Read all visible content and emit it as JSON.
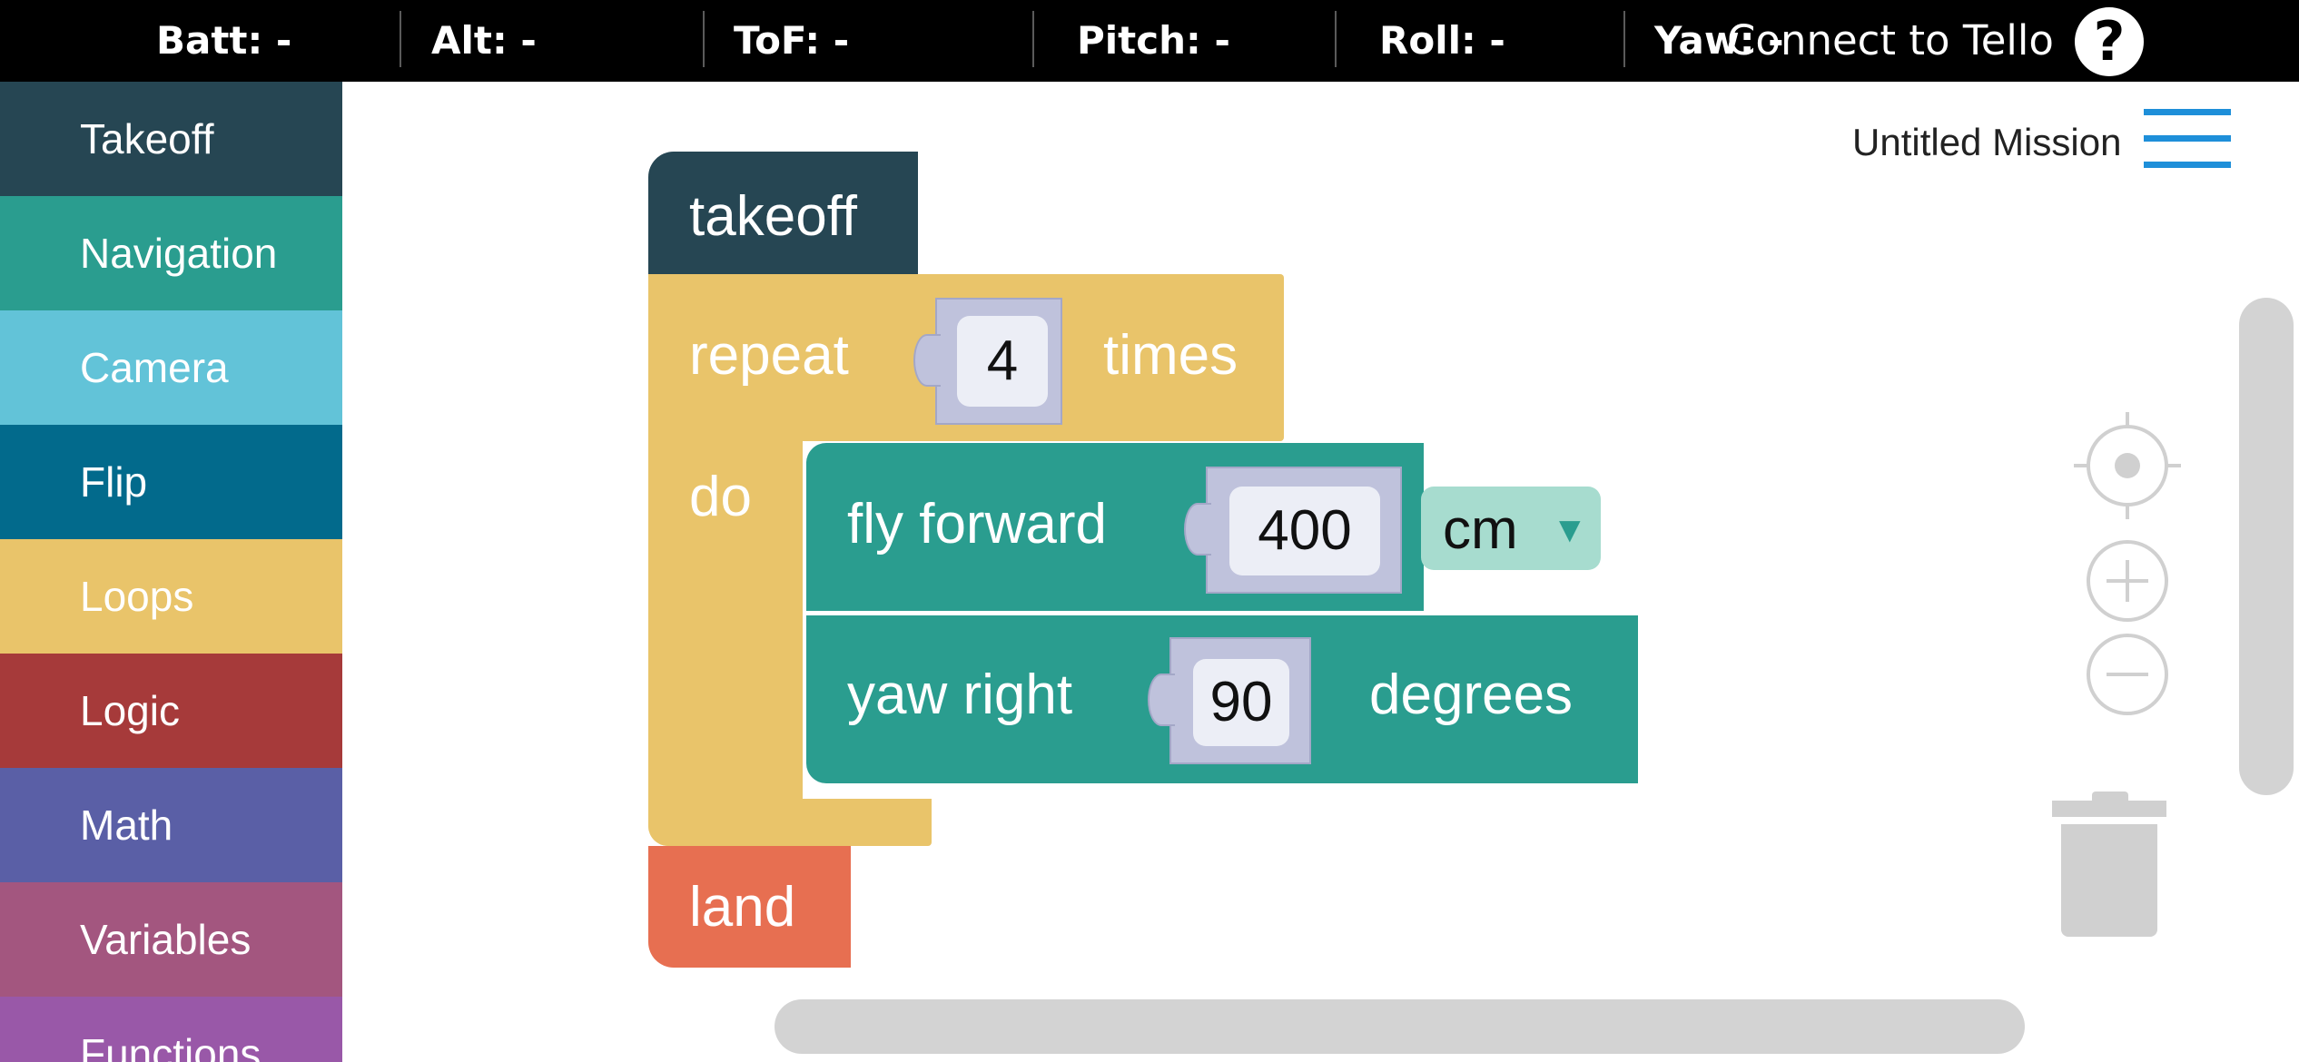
{
  "topbar": {
    "batt": "Batt: -",
    "alt": "Alt: -",
    "tof": "ToF: -",
    "pitch": "Pitch: -",
    "roll": "Roll: -",
    "yaw": "Yaw: -",
    "connect_label": "Connect to Tello",
    "help_label": "?"
  },
  "sidebar": {
    "items": [
      {
        "label": "Takeoff",
        "color": "#264653"
      },
      {
        "label": "Navigation",
        "color": "#2a9d8f"
      },
      {
        "label": "Camera",
        "color": "#62c3d8"
      },
      {
        "label": "Flip",
        "color": "#026a8c"
      },
      {
        "label": "Loops",
        "color": "#e9c46a"
      },
      {
        "label": "Logic",
        "color": "#a63a3a"
      },
      {
        "label": "Math",
        "color": "#5a5fa6"
      },
      {
        "label": "Variables",
        "color": "#a3567f"
      },
      {
        "label": "Functions",
        "color": "#9958a8"
      }
    ]
  },
  "workspace": {
    "mission_title": "Untitled Mission",
    "blocks": {
      "takeoff": {
        "label": "takeoff",
        "color": "#264653"
      },
      "repeat": {
        "label": "repeat",
        "count": "4",
        "times_label": "times",
        "do_label": "do",
        "color": "#e9c46a"
      },
      "fly_forward": {
        "label": "fly forward",
        "distance": "400",
        "unit": "cm",
        "color": "#2a9d8f"
      },
      "yaw_right": {
        "label": "yaw right",
        "angle": "90",
        "degrees_label": "degrees",
        "color": "#2a9d8f"
      },
      "land": {
        "label": "land",
        "color": "#e76f51"
      }
    }
  },
  "icons": [
    "help-icon",
    "menu-icon",
    "recenter-icon",
    "zoom-in-icon",
    "zoom-out-icon",
    "trash-icon",
    "dropdown-arrow-icon"
  ]
}
